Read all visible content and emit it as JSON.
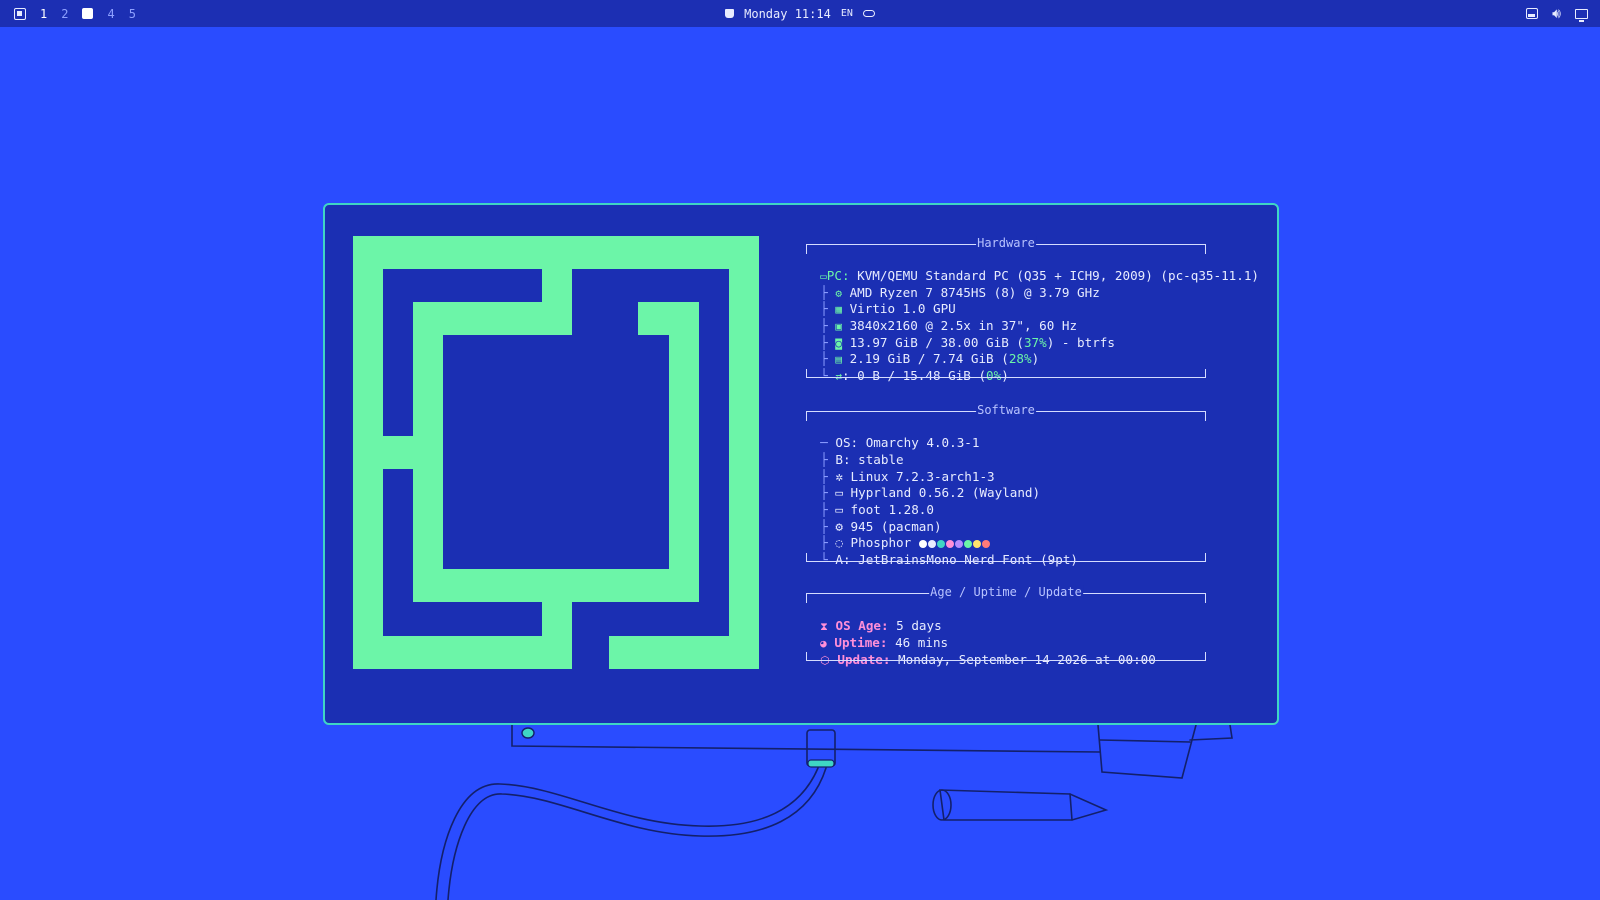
{
  "topbar": {
    "workspaces": [
      "1",
      "2",
      "4",
      "5"
    ],
    "clock": "Monday 11:14",
    "lang": "EN"
  },
  "hardware": {
    "title": "Hardware",
    "rows": [
      {
        "key": "PC:",
        "value": "KVM/QEMU Standard PC (Q35 + ICH9, 2009) (pc-q35-11.1)"
      },
      {
        "value": "AMD Ryzen 7 8745HS (8) @ 3.79 GHz"
      },
      {
        "value": "Virtio 1.0 GPU"
      },
      {
        "value": "3840x2160 @ 2.5x in 37\", 60 Hz"
      },
      {
        "value_a": "13.97 GiB / 38.00 GiB (",
        "pct": "37%",
        "value_b": ") - btrfs"
      },
      {
        "value_a": "2.19 GiB / 7.74 GiB (",
        "pct": "28%",
        "value_b": ")"
      },
      {
        "value_a": ": 0 B / 15.48 GiB (",
        "pct": "0%",
        "value_b": ")"
      }
    ]
  },
  "software": {
    "title": "Software",
    "rows": [
      {
        "key": "OS:",
        "value": "Omarchy 4.0.3-1"
      },
      {
        "value": "stable"
      },
      {
        "value": "Linux 7.2.3-arch1-3"
      },
      {
        "value": "Hyprland 0.56.2 (Wayland)"
      },
      {
        "value": "foot 1.28.0"
      },
      {
        "value": "945 (pacman)"
      },
      {
        "value": "Phosphor"
      },
      {
        "key": "A:",
        "value": "JetBrainsMono Nerd Font (9pt)"
      }
    ],
    "palette": [
      "#ffffff",
      "#e8ecff",
      "#3fd6c4",
      "#ff8fd8",
      "#b58cff",
      "#6cf5a8",
      "#ffe36e",
      "#ff7a7a"
    ]
  },
  "age": {
    "title": "Age / Uptime / Update",
    "rows": [
      {
        "key": "OS Age:",
        "value": "5 days"
      },
      {
        "key": "Uptime:",
        "value": "46 mins"
      },
      {
        "key": "Update:",
        "value": "Monday, September 14 2026 at 00:00"
      }
    ]
  },
  "colors": {
    "desktop": "#2a4cff",
    "panel": "#1b2fb3",
    "accent": "#6cf5a8",
    "border": "#3fd6c4",
    "pink": "#ff8fd8"
  }
}
